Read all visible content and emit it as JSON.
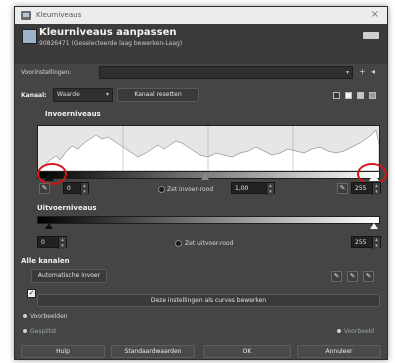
{
  "window": {
    "title": "Kleurniveaus",
    "close_glyph": "×"
  },
  "header": {
    "title": "Kleurniveaus aanpassen",
    "subtitle": "90826471 (Geselecteerde laag bewerken-Laag)"
  },
  "presets": {
    "label": "Voorinstellingen:",
    "value": ""
  },
  "channel": {
    "label": "Kanaal:",
    "value": "Waarde",
    "reset_label": "Kanaal resetten"
  },
  "input_levels": {
    "title": "Invoerniveaus",
    "low": "0",
    "gamma_label": "Zet invoer-rood",
    "gamma": "1,00",
    "high": "255"
  },
  "output_levels": {
    "title": "Uitvoerniveaus",
    "low": "0",
    "mode_label": "Zet uitvoer-rood",
    "high": "255"
  },
  "all_channels": {
    "title": "Alle kanalen",
    "auto_label": "Automatische invoer"
  },
  "curves_button": "Deze instellingen als curves bewerken",
  "mix": {
    "preview_label": "Voorbeelden",
    "split_label": "Gesplitst",
    "split_right": "Voorbeeld"
  },
  "buttons": {
    "help": "Hulp",
    "defaults": "Standaardwaarden",
    "ok": "OK",
    "cancel": "Annuleer"
  },
  "colors": {
    "window": "#454545",
    "highlight": "#d41616",
    "histogram": "#e6e6e6"
  }
}
